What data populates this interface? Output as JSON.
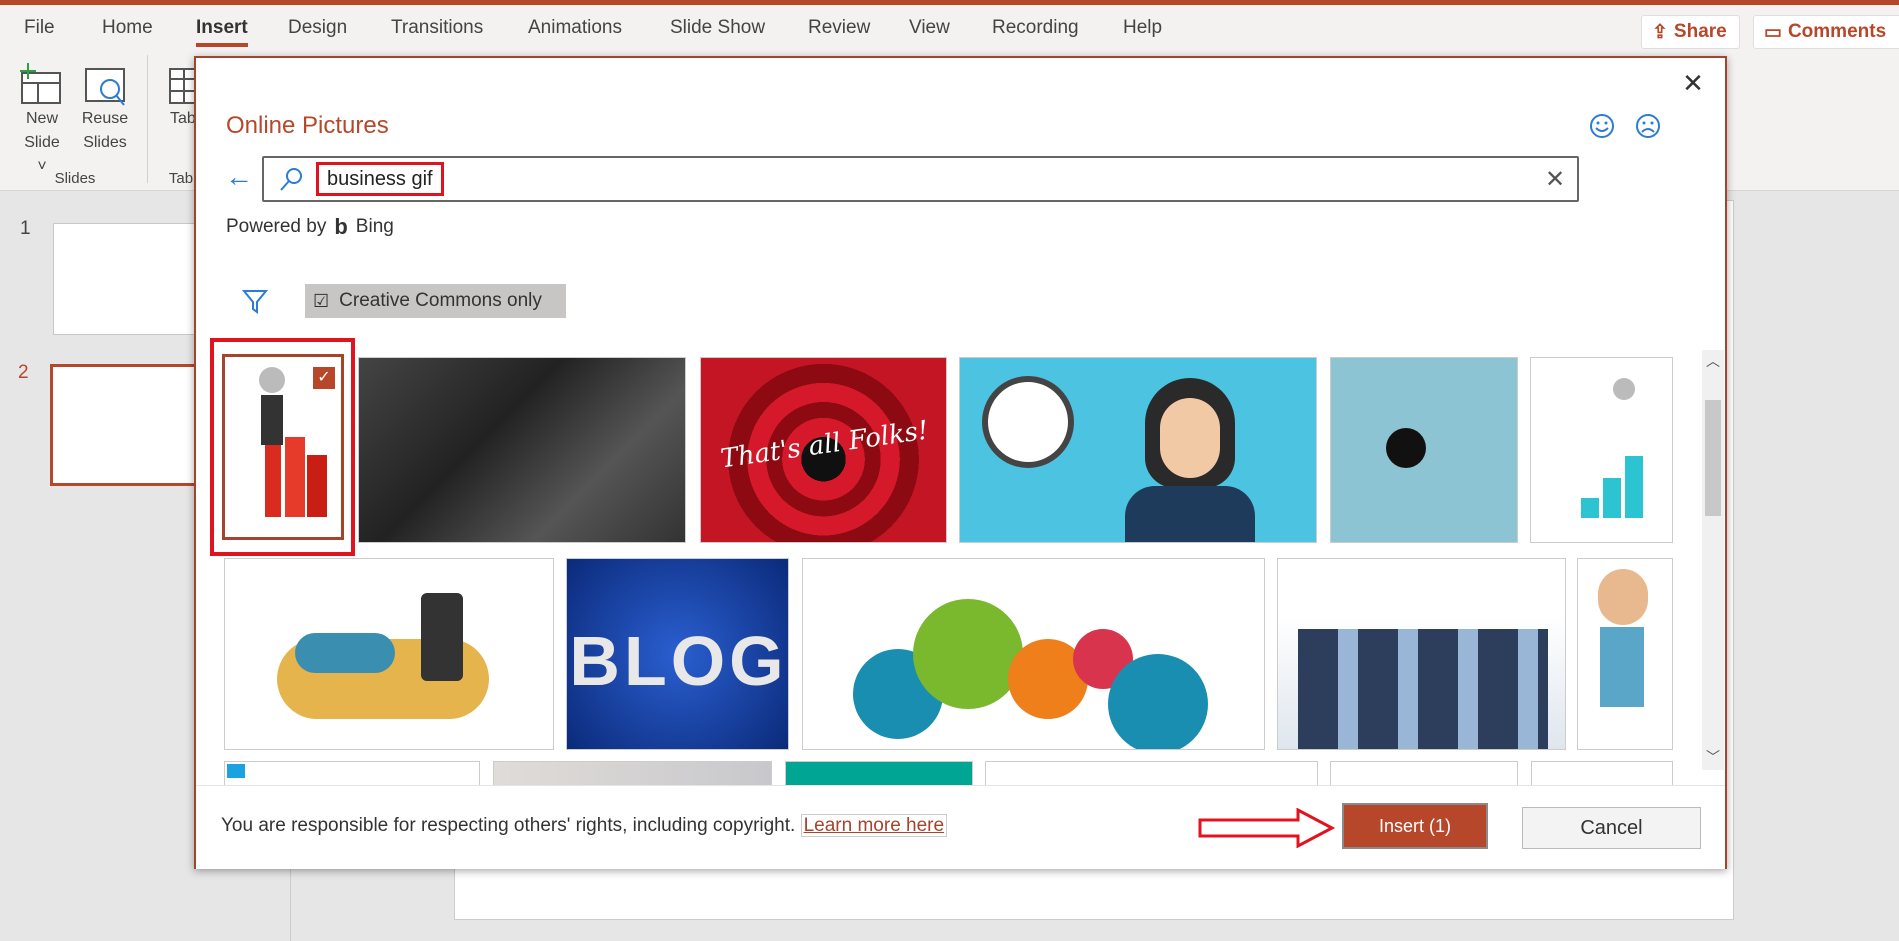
{
  "app": {
    "tabs": [
      "File",
      "Home",
      "Insert",
      "Design",
      "Transitions",
      "Animations",
      "Slide Show",
      "Review",
      "View",
      "Recording",
      "Help"
    ],
    "active_tab": "Insert",
    "share": "Share",
    "comments": "Comments",
    "accent": "#b7472a"
  },
  "ribbon": {
    "new_slide": [
      "New",
      "Slide"
    ],
    "reuse_slides": [
      "Reuse",
      "Slides"
    ],
    "table": [
      "Tab",
      ""
    ],
    "group_slides": "Slides",
    "group_tables": "Tab"
  },
  "slides": {
    "numbers": [
      "1",
      "2"
    ],
    "selected": "2"
  },
  "dialog": {
    "title": "Online Pictures",
    "search_value": "business gif",
    "powered_by": "Powered by",
    "bing": "Bing",
    "filter_chip": "Creative Commons only",
    "notice": "You are responsible for respecting others' rights, including copyright.",
    "learn_more": "Learn more here",
    "insert": "Insert (1)",
    "cancel": "Cancel",
    "images_row1": [
      "3D figure climbing red bar chart (selected)",
      "Business meeting (black and white)",
      "That's all Folks!",
      "Woman with headset and clock",
      "Figure at computer",
      "3D figure climbing chart"
    ],
    "images_row2": [
      "Isometric workspace",
      "BLOG",
      "Running figures on gears",
      "Celebrating business team",
      "Cartoon businessman"
    ],
    "overlay_text": {
      "folks": "That's all Folks!",
      "blog": "BLOG"
    }
  }
}
